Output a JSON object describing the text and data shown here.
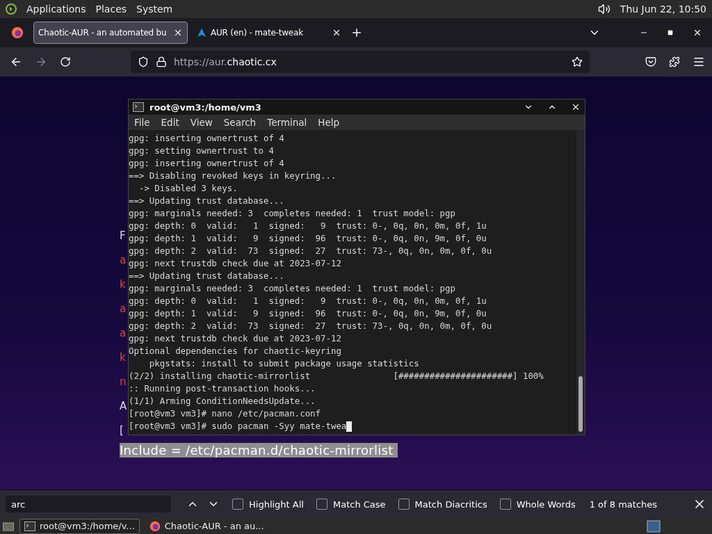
{
  "top_panel": {
    "menus": [
      "Applications",
      "Places",
      "System"
    ],
    "clock": "Thu Jun 22, 10:50"
  },
  "browser_tabs": [
    {
      "label": "Chaotic-AUR - an automated bu",
      "selected": true
    },
    {
      "label": "AUR (en) - mate-tweak",
      "selected": false
    }
  ],
  "address_bar": {
    "url_prefix": "https://aur.",
    "url_domain": "chaotic.cx"
  },
  "page": {
    "side_letters": [
      {
        "text": "F",
        "color": "#d8d8e8"
      },
      {
        "text": "a",
        "color": "#e0403a"
      },
      {
        "text": "k",
        "color": "#e0403a"
      },
      {
        "text": "a",
        "color": "#e0403a"
      },
      {
        "text": "a",
        "color": "#e0403a"
      },
      {
        "text": "k",
        "color": "#e0403a"
      },
      {
        "text": "n",
        "color": "#e0403a"
      },
      {
        "text": "A",
        "color": "#d8d8e8"
      },
      {
        "text": "[",
        "color": "#d8d8e8"
      }
    ],
    "highlighted_line": "Include = /etc/pacman.d/chaotic-mirrorlist"
  },
  "terminal": {
    "title": "root@vm3:/home/vm3",
    "menus": [
      "File",
      "Edit",
      "View",
      "Search",
      "Terminal",
      "Help"
    ],
    "lines": [
      "gpg: inserting ownertrust of 4",
      "gpg: setting ownertrust to 4",
      "gpg: inserting ownertrust of 4",
      "==> Disabling revoked keys in keyring...",
      "  -> Disabled 3 keys.",
      "==> Updating trust database...",
      "gpg: marginals needed: 3  completes needed: 1  trust model: pgp",
      "gpg: depth: 0  valid:   1  signed:   9  trust: 0-, 0q, 0n, 0m, 0f, 1u",
      "gpg: depth: 1  valid:   9  signed:  96  trust: 0-, 0q, 0n, 9m, 0f, 0u",
      "gpg: depth: 2  valid:  73  signed:  27  trust: 73-, 0q, 0n, 0m, 0f, 0u",
      "gpg: next trustdb check due at 2023-07-12",
      "==> Updating trust database...",
      "gpg: marginals needed: 3  completes needed: 1  trust model: pgp",
      "gpg: depth: 0  valid:   1  signed:   9  trust: 0-, 0q, 0n, 0m, 0f, 1u",
      "gpg: depth: 1  valid:   9  signed:  96  trust: 0-, 0q, 0n, 9m, 0f, 0u",
      "gpg: depth: 2  valid:  73  signed:  27  trust: 73-, 0q, 0n, 0m, 0f, 0u",
      "gpg: next trustdb check due at 2023-07-12",
      "Optional dependencies for chaotic-keyring",
      "    pkgstats: install to submit package usage statistics",
      "(2/2) installing chaotic-mirrorlist                [######################] 100%",
      ":: Running post-transaction hooks...",
      "(1/1) Arming ConditionNeedsUpdate...",
      "[root@vm3 vm3]# nano /etc/pacman.conf",
      "[root@vm3 vm3]# sudo pacman -Syy mate-twea"
    ]
  },
  "find_bar": {
    "value": "arc",
    "options": [
      {
        "label": "Highlight All",
        "checked": false
      },
      {
        "label": "Match Case",
        "checked": false
      },
      {
        "label": "Match Diacritics",
        "checked": false
      },
      {
        "label": "Whole Words",
        "checked": false
      }
    ],
    "result": "1 of 8 matches"
  },
  "taskbar": {
    "items": [
      {
        "label": "root@vm3:/home/v...",
        "kind": "terminal"
      },
      {
        "label": "Chaotic-AUR - an au...",
        "kind": "browser"
      }
    ]
  }
}
